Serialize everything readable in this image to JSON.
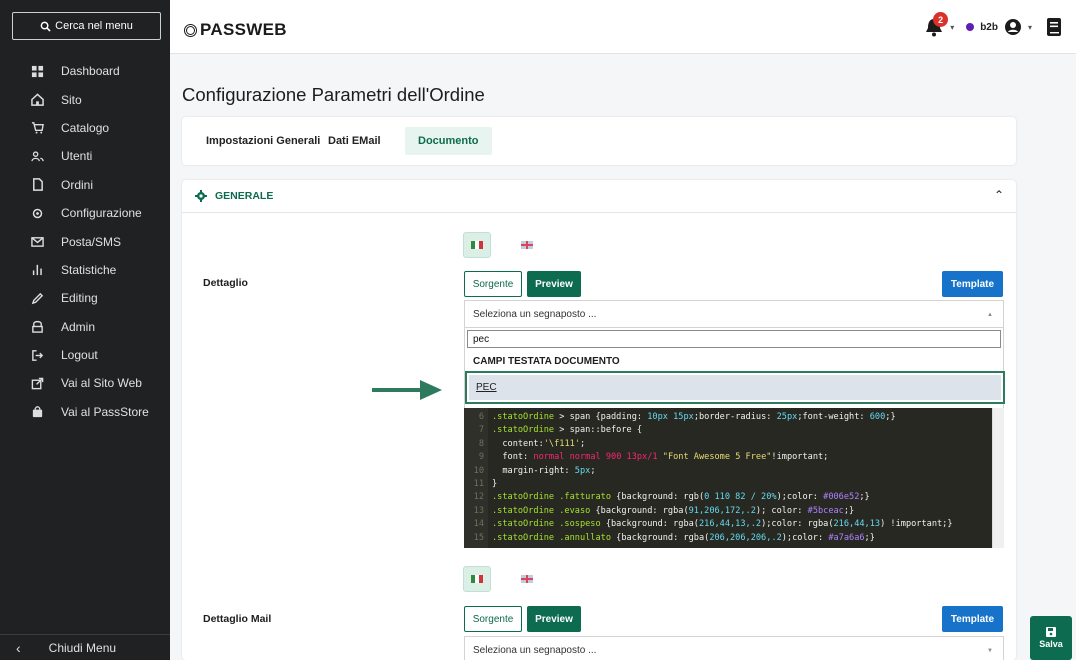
{
  "sidebar": {
    "search_label": "Cerca nel menu",
    "items": [
      {
        "label": "Dashboard",
        "icon": "dashboard-icon"
      },
      {
        "label": "Sito",
        "icon": "home-icon"
      },
      {
        "label": "Catalogo",
        "icon": "cart-icon"
      },
      {
        "label": "Utenti",
        "icon": "users-icon"
      },
      {
        "label": "Ordini",
        "icon": "orders-icon"
      },
      {
        "label": "Configurazione",
        "icon": "gear-icon"
      },
      {
        "label": "Posta/SMS",
        "icon": "mail-icon"
      },
      {
        "label": "Statistiche",
        "icon": "bar-chart-icon"
      },
      {
        "label": "Editing",
        "icon": "pencil-icon"
      },
      {
        "label": "Admin",
        "icon": "admin-icon"
      },
      {
        "label": "Logout",
        "icon": "logout-icon"
      },
      {
        "label": "Vai al Sito Web",
        "icon": "external-link-icon"
      },
      {
        "label": "Vai al PassStore",
        "icon": "shopping-bag-icon"
      }
    ],
    "collapse_label": "Chiudi Menu"
  },
  "header": {
    "logo_text": "PASSWEB",
    "notifications_count": "2",
    "user_label": "b2b"
  },
  "page": {
    "title": "Configurazione Parametri dell'Ordine"
  },
  "tabs": [
    {
      "label": "Impostazioni Generali",
      "active": false
    },
    {
      "label": "Dati EMail",
      "active": false
    },
    {
      "label": "Documento",
      "active": true
    }
  ],
  "section": {
    "title": "GENERALE"
  },
  "dettaglio": {
    "label": "Dettaglio",
    "source_label": "Sorgente",
    "preview_label": "Preview",
    "template_label": "Template",
    "select_placeholder": "Seleziona un segnaposto ...",
    "search_value": "pec",
    "group_label": "CAMPI TESTATA DOCUMENTO",
    "option_label": "PEC"
  },
  "code_lines": [
    {
      "n": "6",
      "parts": [
        [
          ".statoOrdine",
          "sel"
        ],
        [
          " > span {padding: ",
          "prop"
        ],
        [
          "10px 15px",
          "val"
        ],
        [
          ";border-radius: ",
          "prop"
        ],
        [
          "25px",
          "val"
        ],
        [
          ";font-weight: ",
          "prop"
        ],
        [
          "600",
          "val"
        ],
        [
          ";}",
          "prop"
        ]
      ]
    },
    {
      "n": "7",
      "parts": [
        [
          ".statoOrdine",
          "sel"
        ],
        [
          " > span::before {",
          "prop"
        ]
      ]
    },
    {
      "n": "8",
      "parts": [
        [
          "  content:",
          "prop"
        ],
        [
          "'\\f111'",
          "str"
        ],
        [
          ";",
          "prop"
        ]
      ]
    },
    {
      "n": "9",
      "parts": [
        [
          "  font: ",
          "prop"
        ],
        [
          "normal normal 900 13px/1 ",
          "key"
        ],
        [
          "\"Font Awesome 5 Free\"",
          "str"
        ],
        [
          "!important;",
          "prop"
        ]
      ]
    },
    {
      "n": "10",
      "parts": [
        [
          "  margin-right: ",
          "prop"
        ],
        [
          "5px",
          "val"
        ],
        [
          ";",
          "prop"
        ]
      ]
    },
    {
      "n": "11",
      "parts": [
        [
          "}",
          "prop"
        ]
      ]
    },
    {
      "n": "12",
      "parts": [
        [
          ".statoOrdine .fatturato",
          "sel"
        ],
        [
          " {background: rgb(",
          "prop"
        ],
        [
          "0 110 82 / 20%",
          "val"
        ],
        [
          ");color: ",
          "prop"
        ],
        [
          "#006e52",
          "num"
        ],
        [
          ";}",
          "prop"
        ]
      ]
    },
    {
      "n": "13",
      "parts": [
        [
          ".statoOrdine .evaso",
          "sel"
        ],
        [
          " {background: rgba(",
          "prop"
        ],
        [
          "91,206,172,.2",
          "val"
        ],
        [
          "); color: ",
          "prop"
        ],
        [
          "#5bceac",
          "num"
        ],
        [
          ";}",
          "prop"
        ]
      ]
    },
    {
      "n": "14",
      "parts": [
        [
          ".statoOrdine .sospeso",
          "sel"
        ],
        [
          " {background: rgba(",
          "prop"
        ],
        [
          "216,44,13,.2",
          "val"
        ],
        [
          ");color: rgba(",
          "prop"
        ],
        [
          "216,44,13",
          "val"
        ],
        [
          ") !important;}",
          "prop"
        ]
      ]
    },
    {
      "n": "15",
      "parts": [
        [
          ".statoOrdine .annullato",
          "sel"
        ],
        [
          " {background: rgba(",
          "prop"
        ],
        [
          "206,206,206,.2",
          "val"
        ],
        [
          ");color: ",
          "prop"
        ],
        [
          "#a7a6a6",
          "num"
        ],
        [
          ";}",
          "prop"
        ]
      ]
    }
  ],
  "dettaglio_mail": {
    "label": "Dettaglio Mail",
    "source_label": "Sorgente",
    "preview_label": "Preview",
    "template_label": "Template",
    "select_placeholder": "Seleziona un segnaposto ..."
  },
  "save": {
    "label": "Salva"
  },
  "colors": {
    "brand_green": "#0d6b4f",
    "blue": "#1673c9",
    "sidebar_bg": "#1f2123"
  }
}
